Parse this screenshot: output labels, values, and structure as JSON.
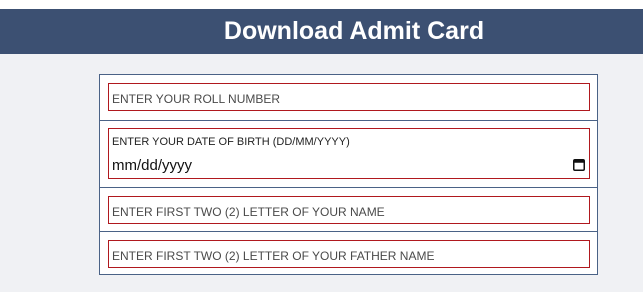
{
  "header": {
    "title": "Download Admit Card"
  },
  "form": {
    "roll_number": {
      "placeholder": "ENTER YOUR ROLL NUMBER"
    },
    "dob": {
      "label": "ENTER YOUR DATE OF BIRTH (DD/MM/YYYY)",
      "value": "mm/dd/yyyy",
      "icon": "calendar-icon"
    },
    "name_letters": {
      "placeholder": "ENTER FIRST TWO (2) LETTER OF YOUR NAME"
    },
    "father_name_letters": {
      "placeholder": "ENTER FIRST TWO (2) LETTER OF YOUR FATHER NAME"
    }
  },
  "colors": {
    "header_bg": "#3c5072",
    "field_border": "#b0181e",
    "form_border": "#4a6286",
    "page_bg": "#f0f1f4"
  }
}
